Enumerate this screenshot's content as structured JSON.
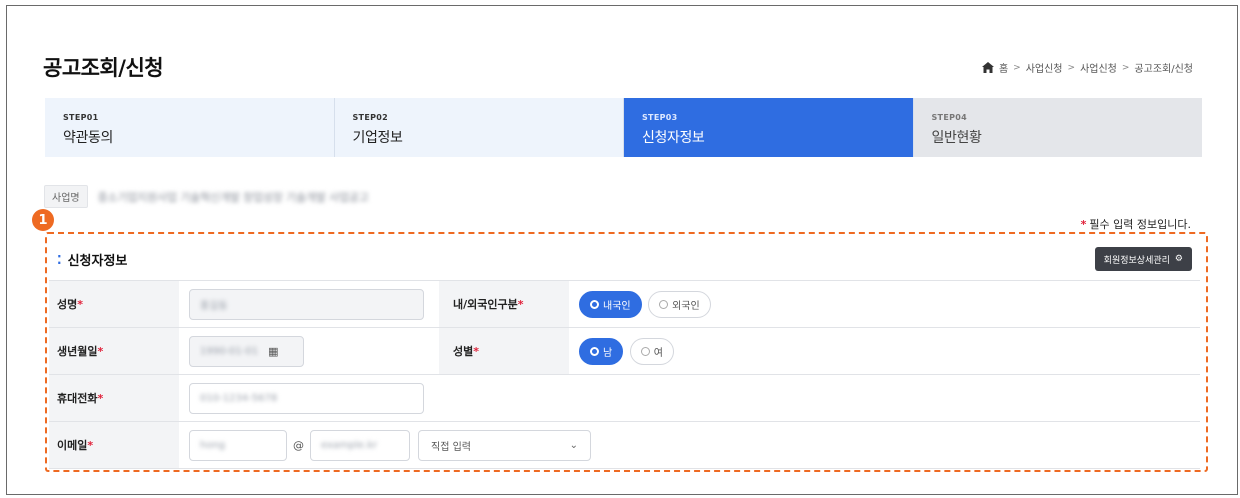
{
  "page": {
    "title": "공고조회/신청",
    "breadcrumb": [
      "홈",
      "사업신청",
      "사업신청",
      "공고조회/신청"
    ]
  },
  "steps": [
    {
      "num": "STEP01",
      "name": "약관동의",
      "state": "done"
    },
    {
      "num": "STEP02",
      "name": "기업정보",
      "state": "done"
    },
    {
      "num": "STEP03",
      "name": "신청자정보",
      "state": "active"
    },
    {
      "num": "STEP04",
      "name": "일반현황",
      "state": "future"
    }
  ],
  "business": {
    "tag": "사업명",
    "name": "중소기업지원사업 기술혁신개발 창업성장 기술개발 사업공고"
  },
  "callout_badge": "1",
  "required_note": "필수 입력 정보입니다.",
  "section": {
    "title": "신청자정보",
    "member_button": "회원정보상세관리"
  },
  "form": {
    "name_label": "성명",
    "name_value": "홍길동",
    "nationality_label": "내/외국인구분",
    "nationality_options": [
      "내국인",
      "외국인"
    ],
    "nationality_selected": "내국인",
    "birth_label": "생년월일",
    "birth_value": "1990-01-01",
    "gender_label": "성별",
    "gender_options": [
      "남",
      "여"
    ],
    "gender_selected": "남",
    "phone_label": "휴대전화",
    "phone_value": "010-1234-5678",
    "email_label": "이메일",
    "email_id": "hong",
    "email_at": "@",
    "email_domain": "example.kr",
    "email_select": "직접 입력"
  },
  "colors": {
    "accent": "#2f6de1",
    "callout": "#ee6a22",
    "required": "#e0223b"
  }
}
